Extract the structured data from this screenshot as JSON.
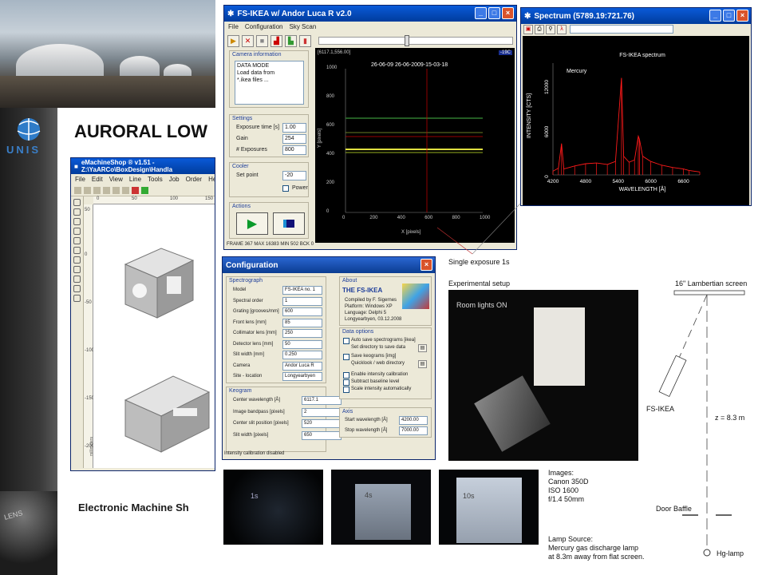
{
  "slide": {
    "title": "AURORAL LOW",
    "logo_text": "UNIS",
    "lens_text": "LENS",
    "bottom_caption": "Electronic Machine Sh"
  },
  "emachineshop": {
    "title": "eMachineShop ® v1.51 - Z:\\YaARCo\\BoxDesign\\Handla",
    "menu": [
      "File",
      "Edit",
      "View",
      "Line",
      "Tools",
      "Job",
      "Order",
      "Help"
    ],
    "ruler_top": [
      "0",
      "50",
      "100",
      "150"
    ],
    "ruler_left": [
      "50",
      "0",
      "-50",
      "-100",
      "-150",
      "-200"
    ],
    "unit_label": "millimeters"
  },
  "fs_main": {
    "title": "FS-IKEA w/ Andor Luca R v2.0",
    "menu": [
      "File",
      "Configuration",
      "Sky Scan"
    ],
    "camera_info": {
      "title": "Camera information",
      "lines": [
        "DATA MODE",
        "Load data from",
        "*.ikea files ..."
      ]
    },
    "settings": {
      "title": "Settings",
      "exposure_label": "Exposure time [s]",
      "exposure": "1.00",
      "gain_label": "Gain",
      "gain": "254",
      "exposures_label": "# Exposures",
      "exposures": "800"
    },
    "cooler": {
      "title": "Cooler",
      "setpoint_label": "Set point",
      "setpoint": "-20",
      "power_label": "Power"
    },
    "actions": {
      "title": "Actions"
    },
    "status": "FRAME 367  MAX 16383  MIN 502  BCK 0",
    "image": {
      "coords": "[6117.1,556.00]",
      "temp": "-19C",
      "timestamp": "26-06-09  26-06-2009-15-03-18",
      "ylabel": "Y [pixels]",
      "xlabel": "X [pixels]",
      "xticks": [
        "0",
        "200",
        "400",
        "600",
        "800",
        "1000"
      ],
      "yticks": [
        "1000",
        "800",
        "600",
        "400",
        "200",
        "0"
      ]
    }
  },
  "chart_data": {
    "type": "line",
    "title": "FS-IKEA spectrum",
    "annotation": "Mercury",
    "xlabel": "WAVELENGTH [Å]",
    "ylabel": "INTENSITY [CTS]",
    "xlim": [
      4200,
      6900
    ],
    "ylim": [
      0,
      15000
    ],
    "xticks": [
      "4200",
      "4800",
      "5400",
      "6000",
      "6600"
    ],
    "yticks": [
      "0",
      "6000",
      "12000"
    ],
    "series": [
      {
        "color": "#ff1a1a",
        "x": [
          4200,
          4300,
          4358,
          4400,
          4600,
          4800,
          5000,
          5200,
          5350,
          5460,
          5500,
          5600,
          5700,
          5770,
          5790,
          5850,
          6000,
          6200,
          6400,
          6600,
          6700,
          6900
        ],
        "y": [
          500,
          900,
          4200,
          800,
          1200,
          1500,
          1600,
          1400,
          1800,
          13000,
          2500,
          1700,
          2000,
          5200,
          4800,
          2500,
          1800,
          1300,
          1000,
          800,
          600,
          400
        ]
      }
    ]
  },
  "spectrum_window": {
    "title": "Spectrum (5789.19:721.76)",
    "tool_icons": [
      "save-icon",
      "print-icon",
      "zoom-icon",
      "lambda-icon"
    ]
  },
  "config": {
    "title": "Configuration",
    "spectrograph_title": "Spectrograph",
    "fields": [
      {
        "label": "Model",
        "value": "FS-IKEA no. 1"
      },
      {
        "label": "Spectral order",
        "value": "1"
      },
      {
        "label": "Grating [grooves/mm]",
        "value": "600"
      },
      {
        "label": "Front lens [mm]",
        "value": "85"
      },
      {
        "label": "Collimator lens [mm]",
        "value": "250"
      },
      {
        "label": "Detector lens [mm]",
        "value": "50"
      },
      {
        "label": "Slit width [mm]",
        "value": "0.250"
      },
      {
        "label": "Camera",
        "value": "Andor Luca R"
      },
      {
        "label": "Site - location",
        "value": "Longyearbyen"
      }
    ],
    "keogram_title": "Keogram",
    "keogram": [
      {
        "label": "Center wavelength [Å]",
        "value": "6117.1"
      },
      {
        "label": "Image bandpass [pixels]",
        "value": "2"
      },
      {
        "label": "Center slit position [pixels]",
        "value": "520"
      },
      {
        "label": "Slit width [pixels]",
        "value": "650"
      }
    ],
    "about_title": "About",
    "about_heading": "THE FS-IKEA",
    "about_lines": [
      "Compiled by F. Sigernes",
      "Platform: Windows XP",
      "Language: Delphi 5",
      "Longyearbyen,  03.12.2008"
    ],
    "data_options_title": "Data options",
    "data_options": [
      "Auto save spectrograms [ikea]",
      "Set directory to save data",
      "Save keograms [img]",
      "Quicklook / web directory"
    ],
    "intensity_options": [
      "Enable intensity calibration",
      "Subtract baseline level",
      "Scale intensity automatically"
    ],
    "axis_title": "Axis",
    "start_label": "Start wavelength [Å]",
    "start": "4200.00",
    "stop_label": "Stop wavelength [Å]",
    "stop": "7000.00",
    "status": "Intensity calibration disabled"
  },
  "annotations": {
    "single_exposure": "Single exposure 1s",
    "experimental_setup": "Experimental setup",
    "room_lights": "Room lights ON",
    "lambertian": "16\" Lambertian screen",
    "fs_ikea": "FS-IKEA",
    "distance": "z = 8.3 m",
    "door_baffle": "Door Baffle",
    "hg_lamp": "Hg-lamp",
    "exp_labels": [
      "1s",
      "4s",
      "10s"
    ],
    "images_lines": [
      "Images:",
      "Canon 350D",
      "ISO 1600",
      "f/1.4 50mm"
    ],
    "lamp_lines": [
      "Lamp Source:",
      "Mercury gas discharge lamp",
      "at 8.3m away from flat screen."
    ]
  }
}
